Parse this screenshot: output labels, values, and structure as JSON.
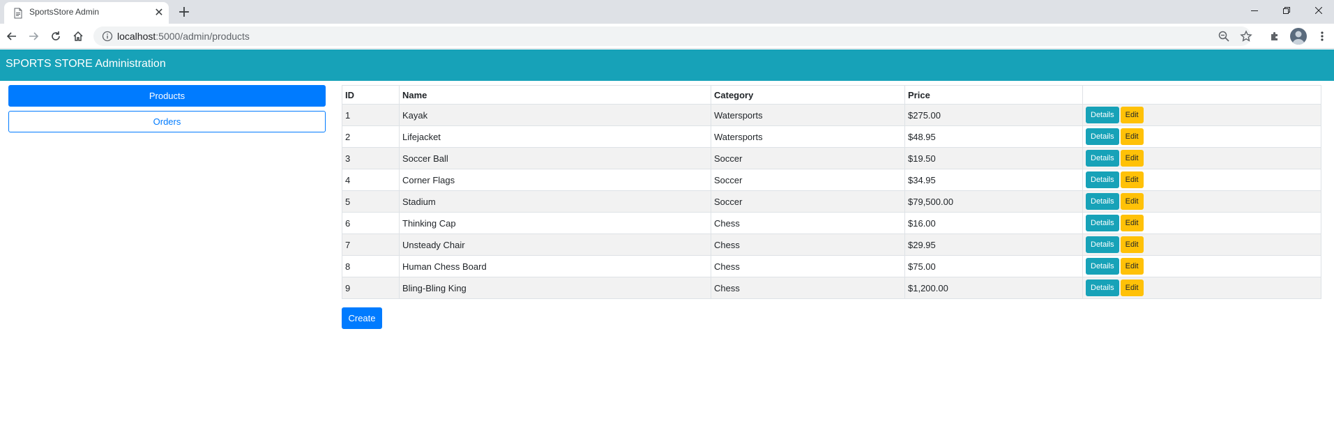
{
  "browser": {
    "tab_title": "SportsStore Admin",
    "url_host": "localhost",
    "url_path": ":5000/admin/products"
  },
  "icons": [
    "page-icon",
    "close-icon",
    "plus-icon",
    "back-icon",
    "forward-icon",
    "reload-icon",
    "home-icon",
    "info-icon",
    "zoom-icon",
    "star-icon",
    "extensions-icon",
    "menu-icon",
    "minimize-icon",
    "restore-icon"
  ],
  "navbar": {
    "brand": "SPORTS STORE Administration"
  },
  "sidebar": {
    "items": [
      {
        "label": "Products",
        "active": true
      },
      {
        "label": "Orders",
        "active": false
      }
    ]
  },
  "table": {
    "headers": [
      "ID",
      "Name",
      "Category",
      "Price",
      ""
    ],
    "rows": [
      {
        "id": "1",
        "name": "Kayak",
        "category": "Watersports",
        "price": "$275.00"
      },
      {
        "id": "2",
        "name": "Lifejacket",
        "category": "Watersports",
        "price": "$48.95"
      },
      {
        "id": "3",
        "name": "Soccer Ball",
        "category": "Soccer",
        "price": "$19.50"
      },
      {
        "id": "4",
        "name": "Corner Flags",
        "category": "Soccer",
        "price": "$34.95"
      },
      {
        "id": "5",
        "name": "Stadium",
        "category": "Soccer",
        "price": "$79,500.00"
      },
      {
        "id": "6",
        "name": "Thinking Cap",
        "category": "Chess",
        "price": "$16.00"
      },
      {
        "id": "7",
        "name": "Unsteady Chair",
        "category": "Chess",
        "price": "$29.95"
      },
      {
        "id": "8",
        "name": "Human Chess Board",
        "category": "Chess",
        "price": "$75.00"
      },
      {
        "id": "9",
        "name": "Bling-Bling King",
        "category": "Chess",
        "price": "$1,200.00"
      }
    ],
    "details_label": "Details",
    "edit_label": "Edit"
  },
  "create_label": "Create",
  "colors": {
    "navbar": "#17a2b8",
    "primary": "#007bff",
    "info": "#17a2b8",
    "warning": "#ffc107"
  }
}
